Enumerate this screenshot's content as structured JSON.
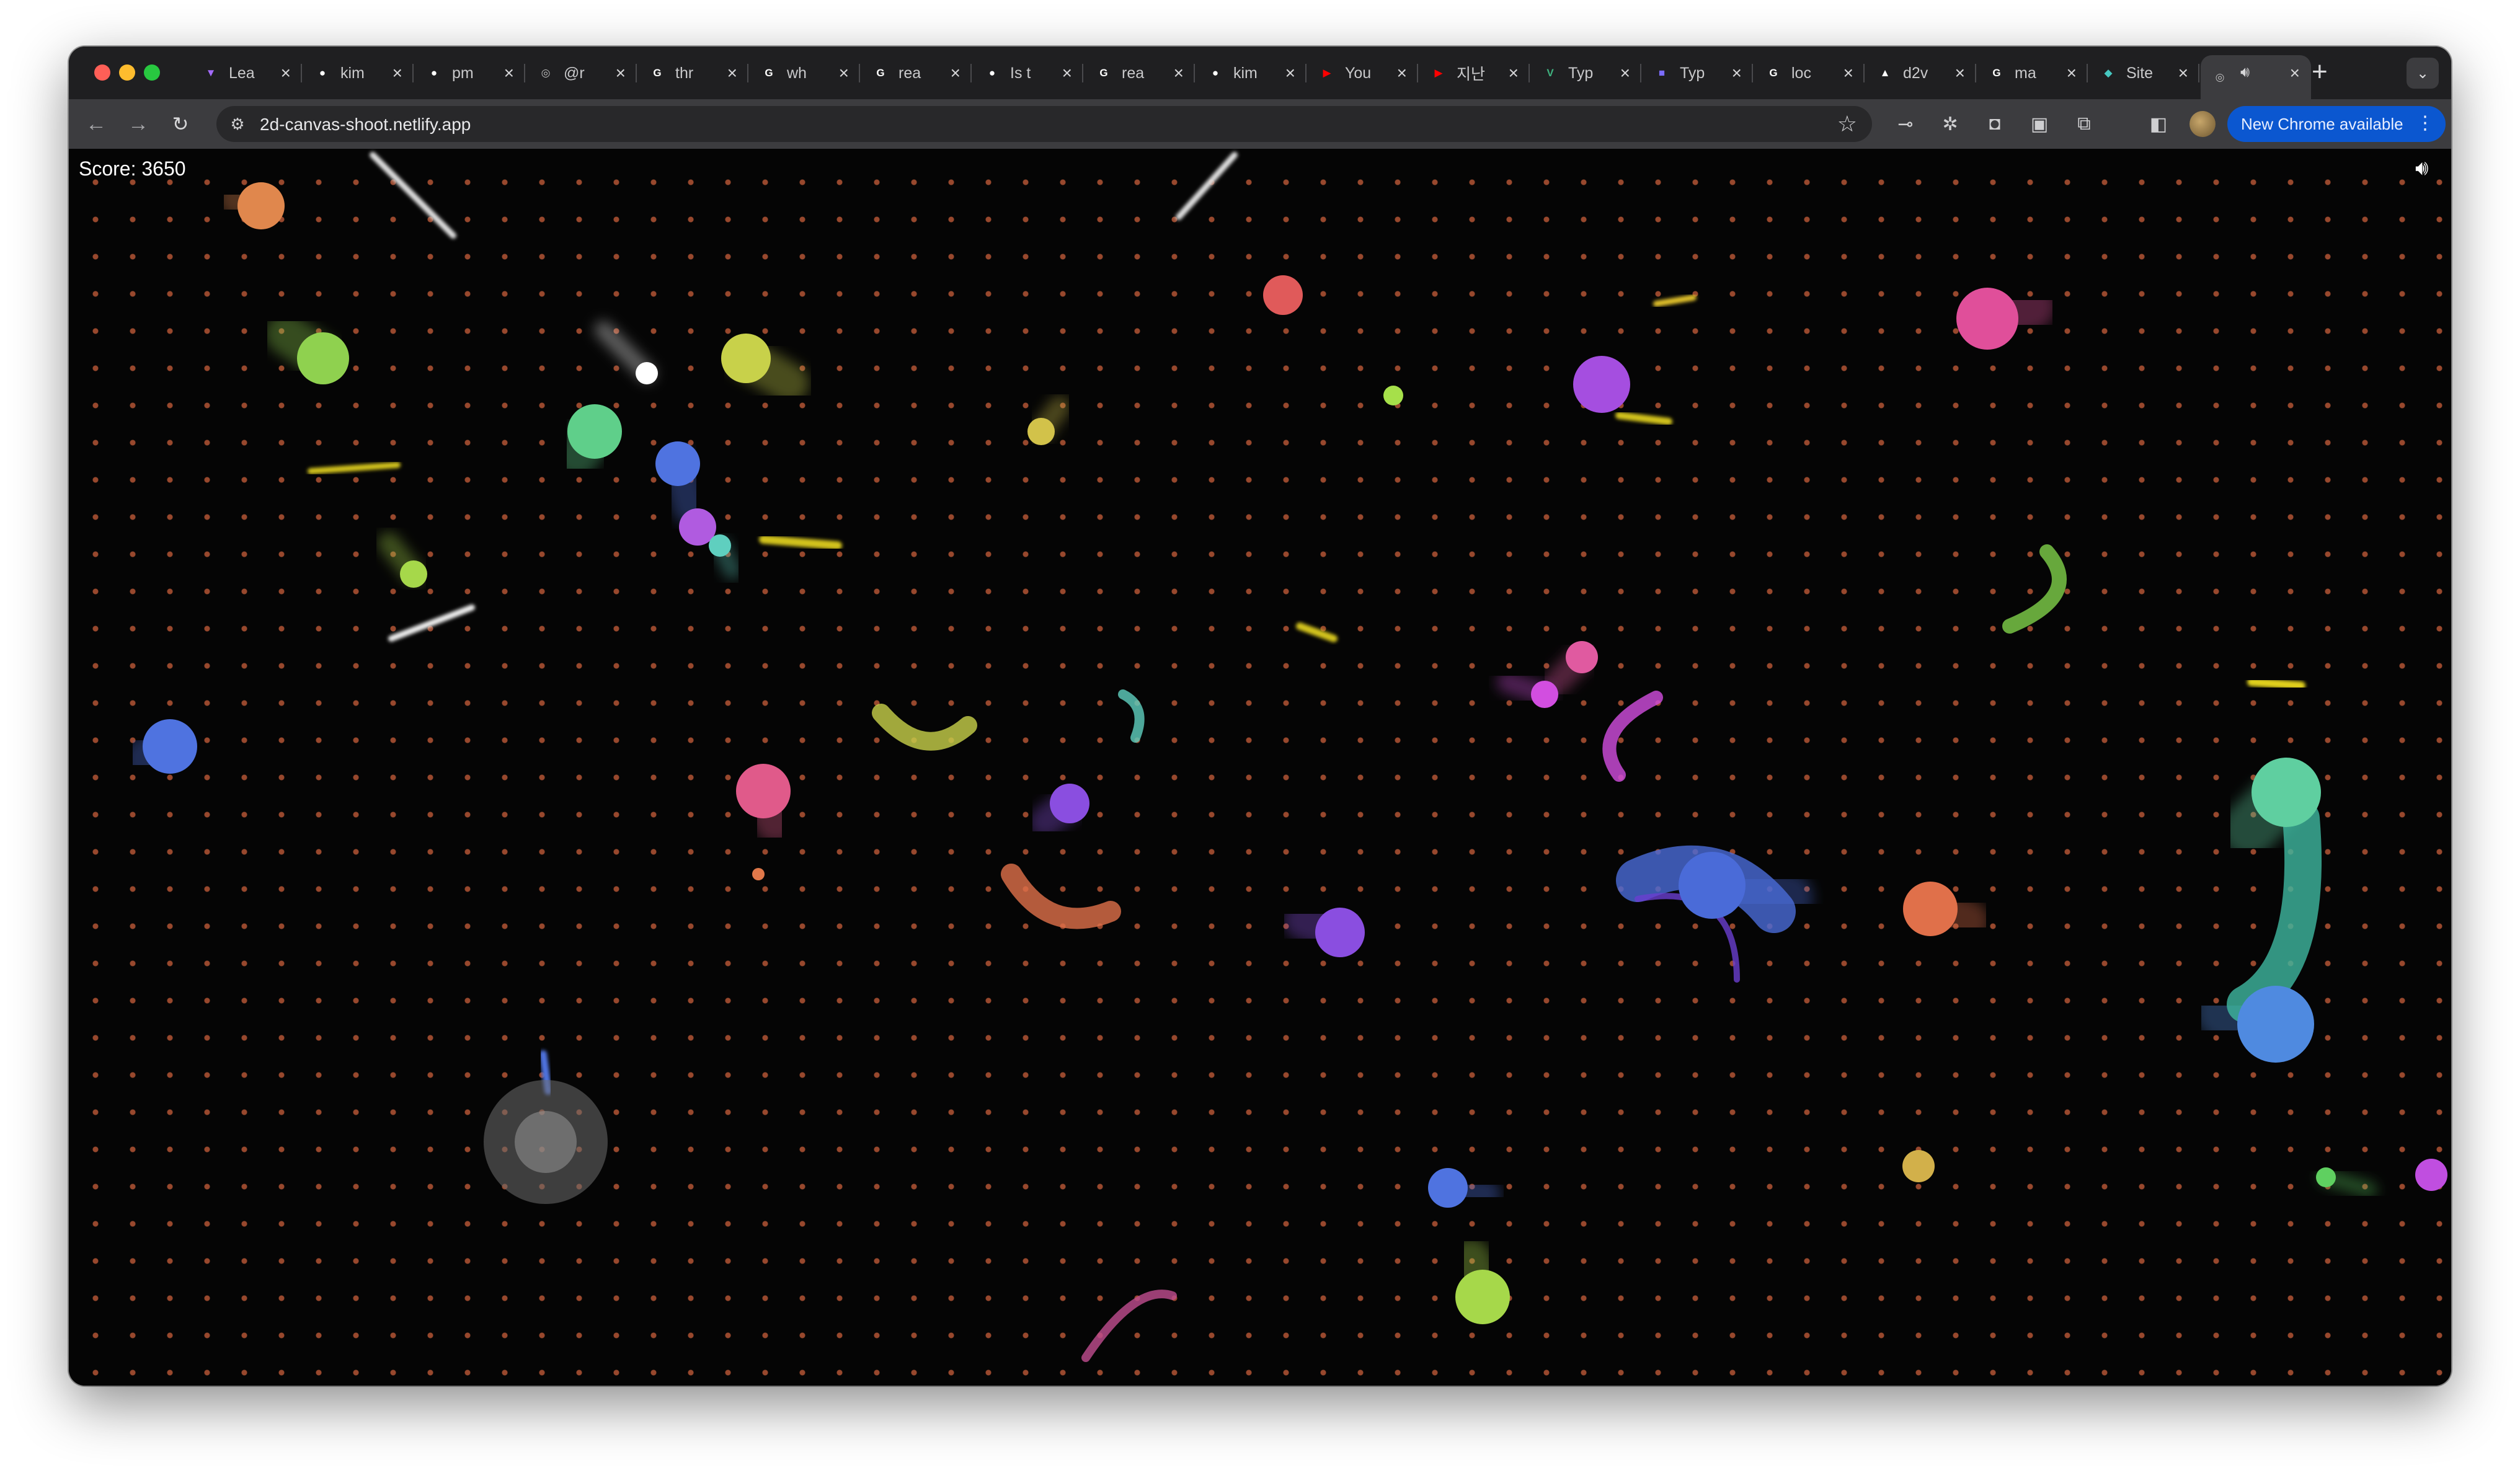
{
  "browser": {
    "tabs": [
      {
        "title": "Lea",
        "favicon": "vite-icon",
        "color": "#a46bff"
      },
      {
        "title": "kim",
        "favicon": "github-icon",
        "color": "#ffffff"
      },
      {
        "title": "pm",
        "favicon": "github-icon",
        "color": "#ffffff"
      },
      {
        "title": "@r",
        "favicon": "globe-icon",
        "color": "#bdbdbd"
      },
      {
        "title": "thr",
        "favicon": "google-icon",
        "color": "#ffffff"
      },
      {
        "title": "wh",
        "favicon": "google-icon",
        "color": "#ffffff"
      },
      {
        "title": "rea",
        "favicon": "google-icon",
        "color": "#ffffff"
      },
      {
        "title": "Is t",
        "favicon": "github-icon",
        "color": "#ffffff"
      },
      {
        "title": "rea",
        "favicon": "google-icon",
        "color": "#ffffff"
      },
      {
        "title": "kim",
        "favicon": "github-icon",
        "color": "#ffffff"
      },
      {
        "title": "You",
        "favicon": "youtube-icon",
        "color": "#ff0000"
      },
      {
        "title": "지난",
        "favicon": "youtube-icon",
        "color": "#ff0000"
      },
      {
        "title": "Typ",
        "favicon": "v-icon",
        "color": "#3fb27f"
      },
      {
        "title": "Typ",
        "favicon": "bookmark-icon",
        "color": "#7b6cff"
      },
      {
        "title": "loc",
        "favicon": "google-icon",
        "color": "#ffffff"
      },
      {
        "title": "d2v",
        "favicon": "triangle-icon",
        "color": "#ffffff"
      },
      {
        "title": "ma",
        "favicon": "google-icon",
        "color": "#ffffff"
      },
      {
        "title": "Site",
        "favicon": "diamond-icon",
        "color": "#46c7c0"
      },
      {
        "title": "",
        "favicon": "globe-icon",
        "color": "#bdbdbd",
        "active": true,
        "audio": true
      }
    ],
    "new_tab": "+",
    "tab_search": "⌄",
    "url": "2d-canvas-shoot.netlify.app",
    "update_label": "New Chrome available",
    "colors": {
      "tab_strip": "#1f1f21",
      "toolbar": "#3c3c3f",
      "omnibox": "#28282a",
      "update": "#0b57d0"
    }
  },
  "game": {
    "score_text": "Score: 3650",
    "sound_icon": "speaker-icon",
    "background": "#050505",
    "grid_dot_color": "#b25434",
    "objects": [
      {
        "kind": "ball",
        "color": "#e0874d"
      },
      {
        "kind": "ball",
        "color": "#8fd14f"
      },
      {
        "kind": "ball",
        "color": "#5fcf8a"
      },
      {
        "kind": "ball",
        "color": "#ffffff"
      },
      {
        "kind": "ball",
        "color": "#c8d14a"
      },
      {
        "kind": "ball",
        "color": "#4f73e0"
      },
      {
        "kind": "ball",
        "color": "#b05be0"
      },
      {
        "kind": "ball",
        "color": "#5fcfbf"
      },
      {
        "kind": "ball",
        "color": "#a6d84a"
      },
      {
        "kind": "ball",
        "color": "#e05a5a"
      },
      {
        "kind": "ball",
        "color": "#d2c24a"
      },
      {
        "kind": "ball",
        "color": "#a6e04a"
      },
      {
        "kind": "ball",
        "color": "#a54ee0"
      },
      {
        "kind": "ball",
        "color": "#e04f9a"
      },
      {
        "kind": "ball",
        "color": "#4f73e0"
      },
      {
        "kind": "ball",
        "color": "#e05a8a"
      },
      {
        "kind": "ball",
        "color": "#8a4ee0"
      },
      {
        "kind": "ball",
        "color": "#e0704a"
      },
      {
        "kind": "ball",
        "color": "#8a4ee0"
      },
      {
        "kind": "ball",
        "color": "#4f73e0"
      },
      {
        "kind": "ball",
        "color": "#a6d84a"
      },
      {
        "kind": "ball",
        "color": "#e05aa0"
      },
      {
        "kind": "ball",
        "color": "#d24ee0"
      },
      {
        "kind": "ball",
        "color": "#e0784a"
      },
      {
        "kind": "ball",
        "color": "#5fcfa0"
      },
      {
        "kind": "ball",
        "color": "#4f8ae0"
      },
      {
        "kind": "ball",
        "color": "#d2b04a"
      },
      {
        "kind": "ball",
        "color": "#5fd060"
      },
      {
        "kind": "ball",
        "color": "#c04ee0"
      },
      {
        "kind": "ball",
        "color": "#4a6bd8"
      }
    ]
  }
}
